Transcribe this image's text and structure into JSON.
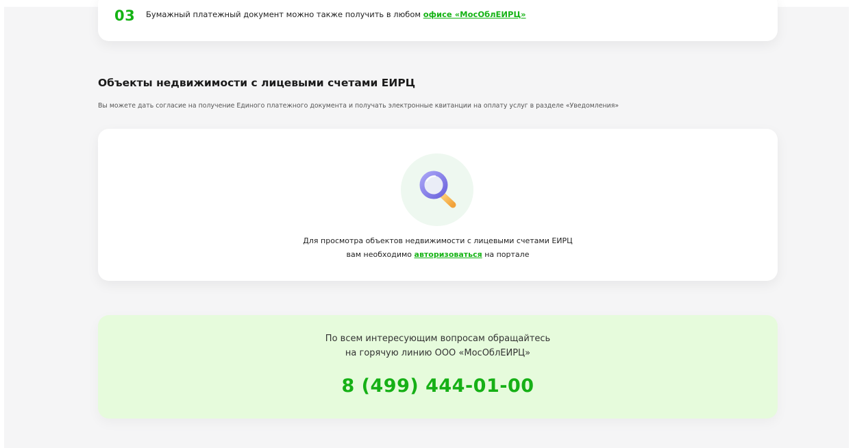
{
  "step": {
    "number": "03",
    "text": "Бумажный платежный документ можно также получить в любом",
    "link_text": "офисе «МосОблЕИРЦ»"
  },
  "section": {
    "title": "Объекты недвижимости с лицевыми счетами ЕИРЦ",
    "subtitle": "Вы можете дать согласие на получение Единого платежного документа и получать электронные квитанции на оплату услуг в разделе «Уведомления»"
  },
  "empty_state": {
    "icon": "search-icon",
    "line1": "Для просмотра объектов недвижимости с лицевыми счетами ЕИРЦ",
    "line2_prefix": "вам необходимо",
    "link_text": "авторизоваться",
    "line2_suffix": "на портале"
  },
  "hotline": {
    "line1": "По всем интересующим вопросам обращайтесь",
    "line2": "на горячую линию ООО «МосОблЕИРЦ»",
    "phone": "8 (499) 444-01-00"
  },
  "colors": {
    "accent": "#15b315",
    "page_bg": "#f5f5f6",
    "hotline_bg": "#e6fbdc"
  }
}
